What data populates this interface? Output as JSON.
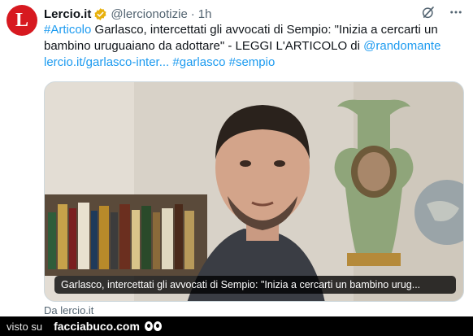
{
  "author": {
    "avatar_letter": "L",
    "name": "Lercio.it",
    "handle": "@lercionotizie",
    "separator": "·",
    "time": "1h"
  },
  "icons": {
    "grok": "grok-icon",
    "more": "more-icon",
    "verified": "verified-icon"
  },
  "tweet": {
    "hashtag_articolo": "#Articolo",
    "line1_rest": "Garlasco, intercettati gli avvocati di Sempio: \"Inizia a cercarti un",
    "line2_text": "bambino uruguaiano da adottare\" - LEGGI L'ARTICOLO di",
    "mention": "@randomante",
    "url": "lercio.it/garlasco-inter...",
    "hashtag_garlasco": "#garlasco",
    "hashtag_sempio": "#sempio"
  },
  "media": {
    "caption": "Garlasco, intercettati gli avvocati di Sempio: \"Inizia a cercarti un bambino urug..."
  },
  "from_label": "Da lercio.it",
  "footer": {
    "visto_su": "visto su",
    "brand": "facciabuco.com"
  },
  "colors": {
    "link": "#1d9bf0",
    "avatar_bg": "#d71920",
    "verified_badge": "#e8b10d",
    "muted": "#536471"
  }
}
